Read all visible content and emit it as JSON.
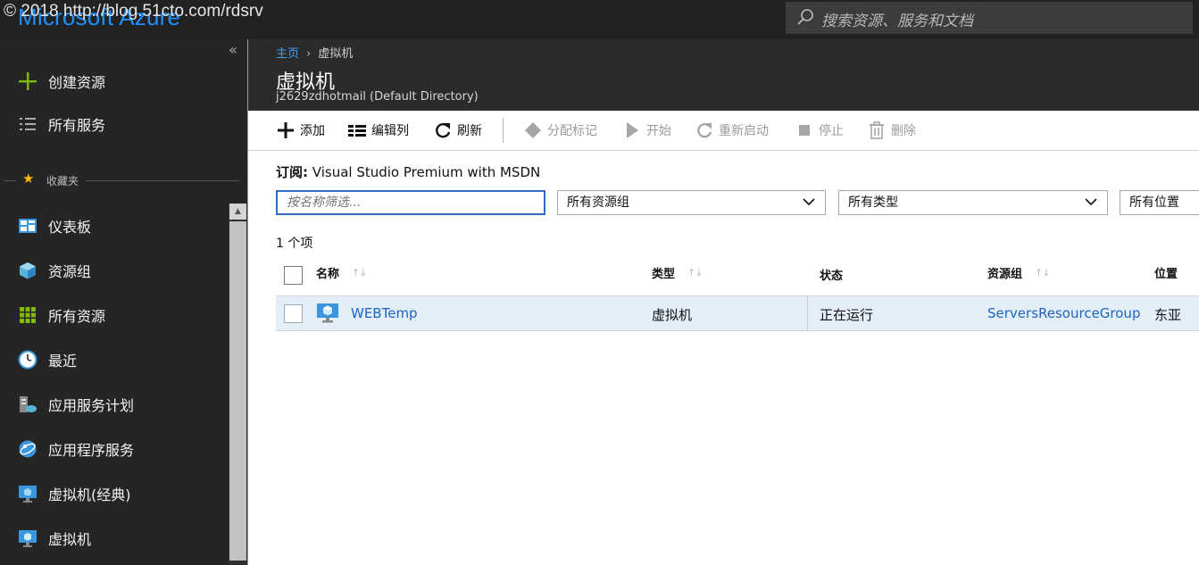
{
  "topbar": {
    "brand": "Microsoft Azure",
    "watermark": "© 2018 http://blog.51cto.com/rdsrv",
    "search_placeholder": "搜索资源、服务和文档"
  },
  "sidebar": {
    "collapse_glyph": "«",
    "create": "创建资源",
    "all_services": "所有服务",
    "favorites_header": "收藏夹",
    "items": [
      {
        "label": "仪表板",
        "icon": "dashboard-icon"
      },
      {
        "label": "资源组",
        "icon": "resource-group-icon"
      },
      {
        "label": "所有资源",
        "icon": "all-resources-icon"
      },
      {
        "label": "最近",
        "icon": "clock-icon"
      },
      {
        "label": "应用服务计划",
        "icon": "app-service-plan-icon"
      },
      {
        "label": "应用程序服务",
        "icon": "app-services-icon"
      },
      {
        "label": "虚拟机(经典)",
        "icon": "vm-classic-icon"
      },
      {
        "label": "虚拟机",
        "icon": "vm-icon"
      }
    ]
  },
  "header": {
    "breadcrumb_home": "主页",
    "breadcrumb_sep": "›",
    "breadcrumb_current": "虚拟机",
    "title": "虚拟机",
    "subtitle": "j2629zdhotmail (Default Directory)"
  },
  "toolbar": {
    "add": "添加",
    "edit_columns": "编辑列",
    "refresh": "刷新",
    "assign_tags": "分配标记",
    "start": "开始",
    "restart": "重新启动",
    "stop": "停止",
    "delete": "删除"
  },
  "subscription": {
    "label": "订阅:",
    "value": "Visual Studio Premium with MSDN"
  },
  "filters": {
    "name_placeholder": "按名称筛选...",
    "resource_group": "所有资源组",
    "type": "所有类型",
    "location": "所有位置"
  },
  "count_text": "1 个项",
  "table": {
    "headers": {
      "name": "名称",
      "type": "类型",
      "status": "状态",
      "resource_group": "资源组",
      "location": "位置"
    },
    "sort_glyph": "↑↓",
    "rows": [
      {
        "name": "WEBTemp",
        "type": "虚拟机",
        "status": "正在运行",
        "resource_group": "ServersResourceGroup",
        "location": "东亚"
      }
    ]
  },
  "colors": {
    "accent": "#1e90ff",
    "link": "#1d64c4",
    "row_selected": "#e4eef8",
    "topbar": "#222222",
    "sidebar": "#252525"
  }
}
